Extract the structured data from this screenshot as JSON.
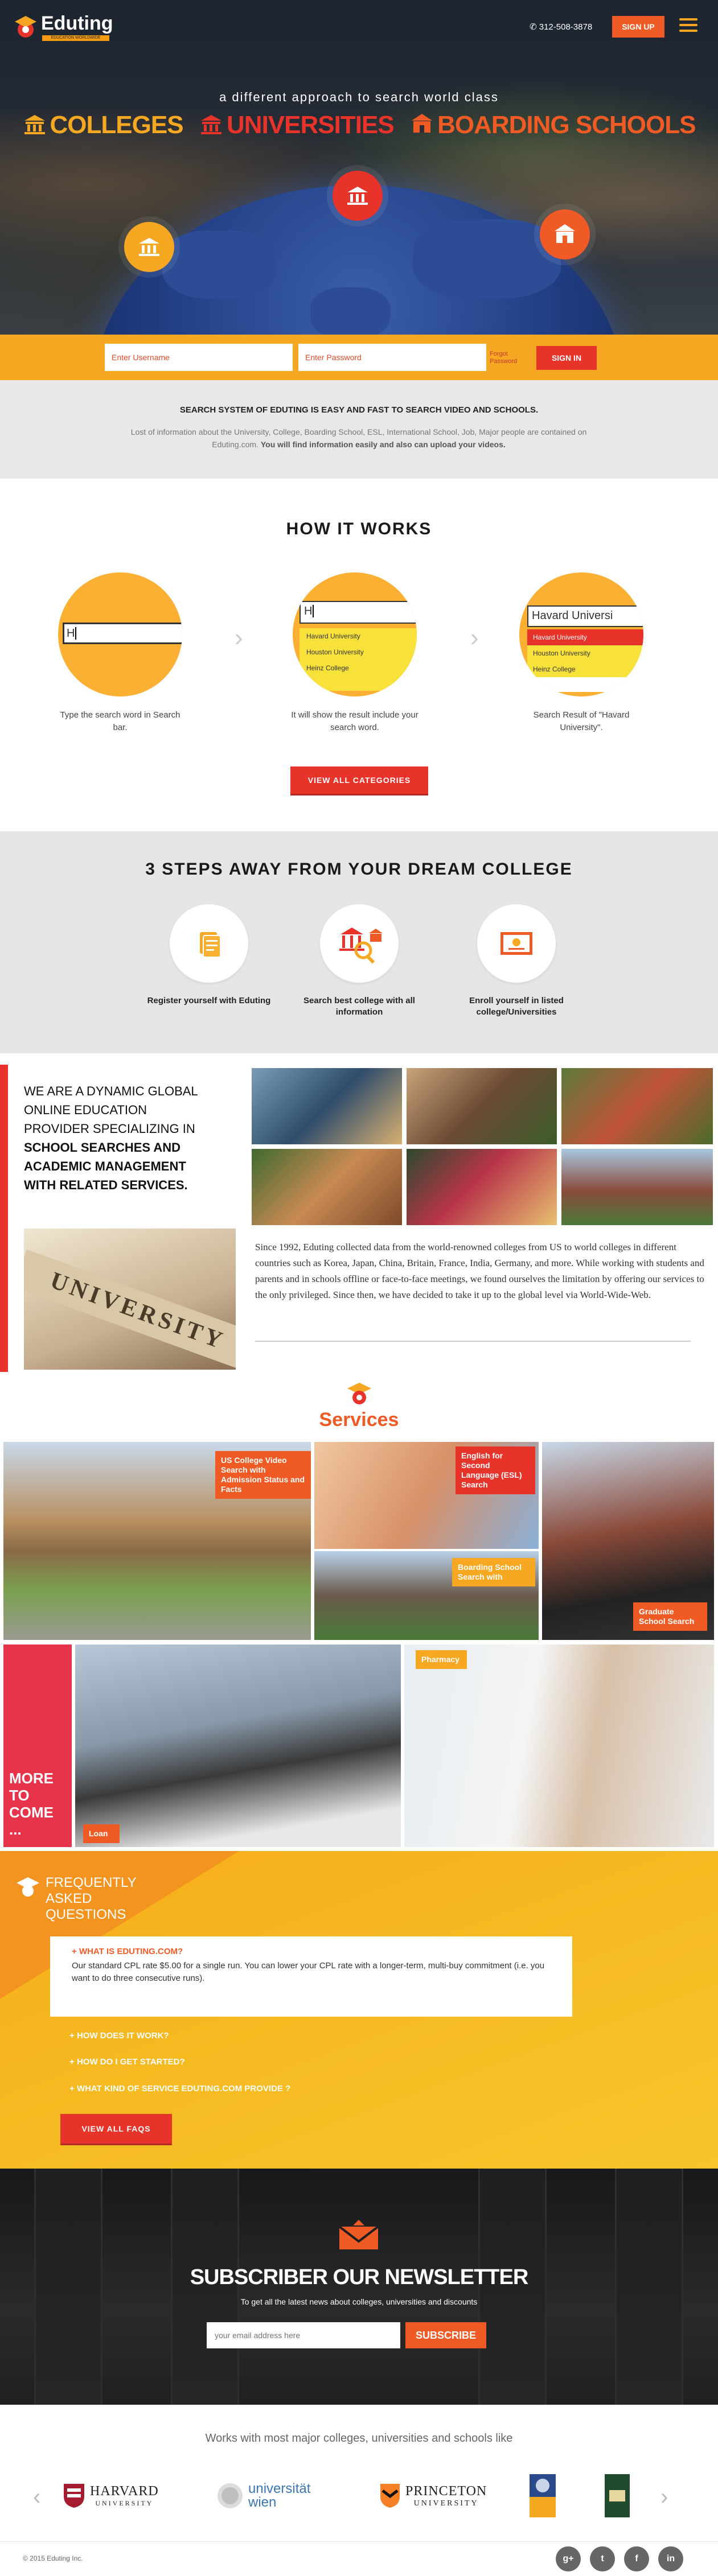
{
  "brand": {
    "name": "Eduting",
    "tag": "EDUCATION WORLDWIDE"
  },
  "header": {
    "phone": "312-508-3878",
    "signup": "SIGN UP"
  },
  "hero": {
    "tagline": "a different approach to search world class",
    "categories": [
      {
        "label": "COLLEGES",
        "color": "#f7a823"
      },
      {
        "label": "UNIVERSITIES",
        "color": "#e8332a"
      },
      {
        "label": "BOARDING SCHOOLS",
        "color": "#f05a24"
      }
    ]
  },
  "login": {
    "username_placeholder": "Enter Username",
    "password_placeholder": "Enter Password",
    "forgot": "Forgot Password",
    "signin": "SIGN IN"
  },
  "info": {
    "title": "SEARCH SYSTEM OF EDUTING IS EASY AND FAST TO SEARCH VIDEO AND SCHOOLS.",
    "body": "Lost of information about the University, College, Boarding School, ESL, International School, Job, Major people are contained on Eduting.com.",
    "body_bold": "You will find information easily and also can upload your videos."
  },
  "how": {
    "title": "HOW IT WORKS",
    "steps": [
      {
        "caption": "Type the search word in Search bar.",
        "input": "H"
      },
      {
        "caption": "It will show the result include your search word.",
        "input": "H",
        "results": [
          "Havard University",
          "Houston University",
          "Heinz College"
        ]
      },
      {
        "caption": "Search Result of \"Havard University\".",
        "input": "Havard Universi",
        "results": [
          "Havard University",
          "Houston University",
          "Heinz College"
        ]
      }
    ],
    "button": "VIEW ALL CATEGORIES"
  },
  "steps3": {
    "title": "3 STEPS AWAY FROM YOUR DREAM COLLEGE",
    "items": [
      {
        "label": "Register yourself with Eduting"
      },
      {
        "label": "Search best college with all information"
      },
      {
        "label": "Enroll yourself in listed college/Universities"
      }
    ]
  },
  "about": {
    "lead": "WE ARE A DYNAMIC GLOBAL ONLINE EDUCATION PROVIDER SPECIALIZING IN",
    "lead_bold": "SCHOOL SEARCHES AND ACADEMIC MANAGEMENT WITH RELATED SERVICES.",
    "body": "Since 1992, Eduting collected data from the world-renowned colleges from US to world colleges in different countries such as Korea, Japan, China, Britain, France, India, Germany, and more. While working with students and parents and in schools offline or face-to-face meetings, we found ourselves the limitation by offering our services to the only privileged. Since then, we have decided to take it up to the global level via World-Wide-Web.",
    "sign": "UNIVERSITY"
  },
  "services": {
    "title": "Services",
    "items": [
      {
        "label": "US College Video Search with Admission Status and Facts"
      },
      {
        "label": "English for Second Language (ESL) Search"
      },
      {
        "label": "Boarding School Search with"
      },
      {
        "label": "Graduate School Search"
      },
      {
        "label": "MORE TO COME ..."
      },
      {
        "label": "Loan"
      },
      {
        "label": "Pharmacy"
      }
    ]
  },
  "faq": {
    "title": "FREQUENTLY ASKED QUESTIONS",
    "open": {
      "q": "WHAT IS EDUTING.COM?",
      "a": "Our standard CPL rate $5.00 for a single run. You can lower your CPL rate with a longer-term, multi-buy commitment (i.e. you want to do three consecutive runs)."
    },
    "questions": [
      "HOW DOES IT WORK?",
      "HOW DO I GET STARTED?",
      "WHAT KIND OF SERVICE EDUTING.COM PROVIDE ?"
    ],
    "button": "VIEW ALL FAQS"
  },
  "newsletter": {
    "title": "SUBSCRIBER OUR NEWSLETTER",
    "sub": "To get all the latest news about colleges, universities and discounts",
    "placeholder": "your email address here",
    "button": "SUBSCRIBE"
  },
  "partners": {
    "title": "Works with most major colleges, universities and schools like",
    "logos": [
      {
        "name": "HARVARD",
        "sub": "UNIVERSITY"
      },
      {
        "name": "universität",
        "sub": "wien"
      },
      {
        "name": "PRINCETON",
        "sub": "UNIVERSITY"
      }
    ]
  },
  "footer": {
    "copyright": "© 2015 Eduting Inc.",
    "social": [
      "g+",
      "t",
      "f",
      "in"
    ]
  }
}
